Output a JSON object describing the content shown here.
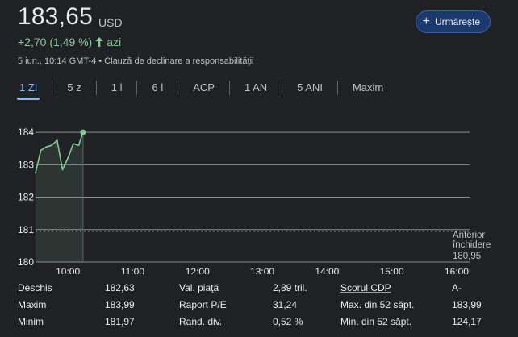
{
  "quote": {
    "price": "183,65",
    "currency": "USD",
    "change": "+2,70 (1,49 %)",
    "change_period": "azi",
    "date_line": "5 iun., 10:14 GMT-4 • Clauză de declinare a responsabilităţii",
    "follow_label": "Urmărește",
    "colors": {
      "positive": "#81c995",
      "accent": "#8ab4f8",
      "background": "#202124"
    }
  },
  "tabs": [
    {
      "label": "1 ZI",
      "active": true
    },
    {
      "label": "5 z"
    },
    {
      "label": "1 l"
    },
    {
      "label": "6 l"
    },
    {
      "label": "ACP"
    },
    {
      "label": "1 AN"
    },
    {
      "label": "5 ANI"
    },
    {
      "label": "Maxim"
    }
  ],
  "chart_data": {
    "type": "area",
    "y_ticks": [
      "184",
      "183",
      "182",
      "181",
      "180"
    ],
    "x_ticks": [
      "10:00",
      "11:00",
      "12:00",
      "13:00",
      "14:00",
      "15:00",
      "16:00"
    ],
    "ylim": [
      180,
      184.4
    ],
    "xlim_hours": [
      9.5,
      16.2
    ],
    "grid": true,
    "series": [
      {
        "x": [
          "9:30",
          "9:35",
          "9:40",
          "9:45",
          "9:50",
          "9:55",
          "10:00",
          "10:05",
          "10:10",
          "10:14"
        ],
        "values": [
          182.75,
          183.45,
          183.55,
          183.6,
          183.75,
          182.85,
          183.2,
          183.65,
          183.6,
          184.0
        ]
      }
    ],
    "previous_close": {
      "value": 180.95,
      "label_line1": "Anterior",
      "label_line2": "închidere",
      "label_value": "180,95"
    }
  },
  "stats": {
    "rows": [
      [
        {
          "label": "Deschis",
          "value": "182,63"
        },
        {
          "label": "Val. piaţă",
          "value": "2,89 tril."
        },
        {
          "label": "Scorul CDP",
          "value": "A-",
          "underline": true
        }
      ],
      [
        {
          "label": "Maxim",
          "value": "183,99"
        },
        {
          "label": "Raport P/E",
          "value": "31,24"
        },
        {
          "label": "Max. din 52 săpt.",
          "value": "183,99"
        }
      ],
      [
        {
          "label": "Minim",
          "value": "181,97"
        },
        {
          "label": "Rand. div.",
          "value": "0,52 %"
        },
        {
          "label": "Min. din 52 săpt.",
          "value": "124,17"
        }
      ]
    ]
  }
}
